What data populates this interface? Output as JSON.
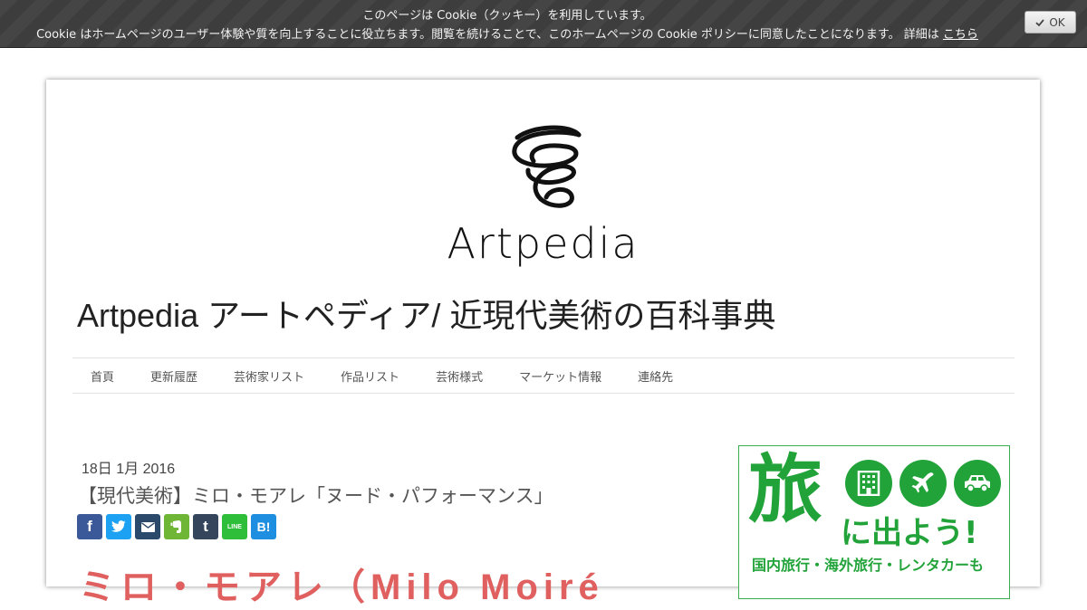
{
  "cookie_bar": {
    "line1": "このページは Cookie（クッキー）を利用しています。",
    "line2": "Cookie はホームページのユーザー体験や質を向上することに役立ちます。閲覧を続けることで、このホームページの Cookie ポリシーに同意したことになります。 詳細は",
    "link_label": "こちら",
    "ok_label": "OK",
    "ok_icon": "check-icon"
  },
  "logo": {
    "icon": "spiral-icon",
    "text": "Artpedia"
  },
  "site_title": "Artpedia アートペディア/ 近現代美術の百科事典",
  "nav": {
    "items": [
      "首頁",
      "更新履歴",
      "芸術家リスト",
      "作品リスト",
      "芸術様式",
      "マーケット情報",
      "連絡先"
    ]
  },
  "post": {
    "date": "18日 1月 2016",
    "title": "【現代美術】ミロ・モアレ「ヌード・パフォーマンス」",
    "share_buttons": [
      {
        "service": "facebook",
        "icon": "facebook-icon",
        "glyph": "f",
        "color": "#3b5998"
      },
      {
        "service": "twitter",
        "icon": "twitter-icon",
        "glyph": "",
        "color": "#1da1f2"
      },
      {
        "service": "email",
        "icon": "mail-icon",
        "glyph": "",
        "color": "#2b4a6b"
      },
      {
        "service": "evernote",
        "icon": "evernote-icon",
        "glyph": "",
        "color": "#6fb536"
      },
      {
        "service": "tumblr",
        "icon": "tumblr-icon",
        "glyph": "t",
        "color": "#35465c"
      },
      {
        "service": "line",
        "icon": "line-icon",
        "glyph": "LINE",
        "color": "#2fbe3a"
      },
      {
        "service": "hatena",
        "icon": "hatena-bookmark-icon",
        "glyph": "B!",
        "color": "#1e8fe0"
      }
    ],
    "heading_partial": "ミロ・モアレ（Milo Moiré"
  },
  "ad": {
    "big_char": "旅",
    "sub": "に出よう!",
    "line": "国内旅行・海外旅行・レンタカーも",
    "icons": [
      "building-icon",
      "airplane-icon",
      "car-icon"
    ],
    "color": "#22a33a"
  }
}
